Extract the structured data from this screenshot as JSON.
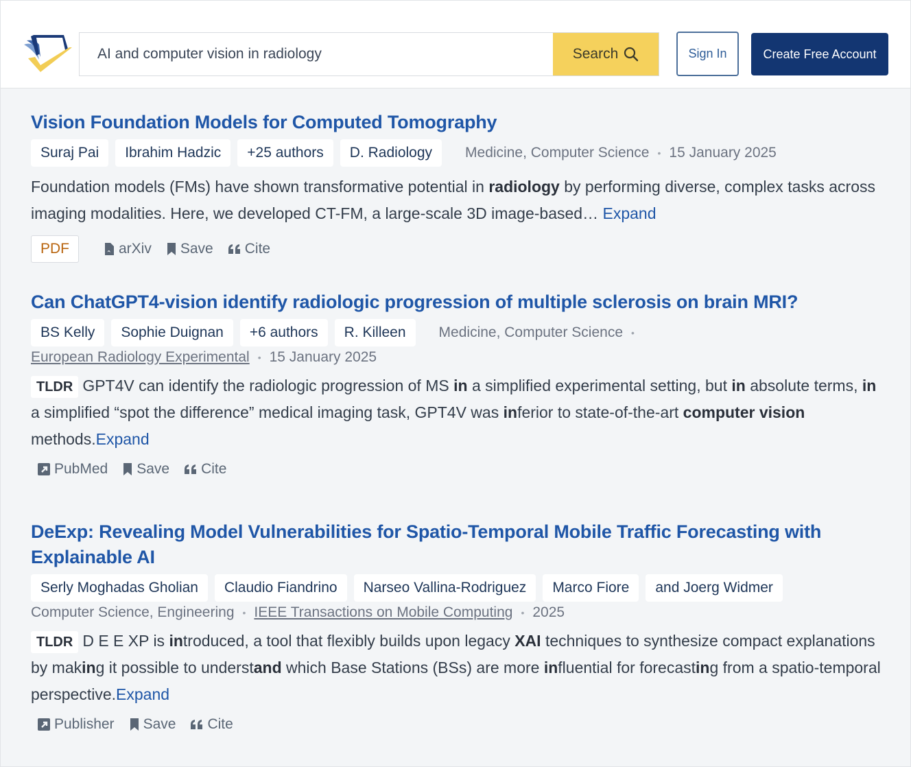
{
  "header": {
    "search_value": "AI and computer vision in radiology",
    "search_button": "Search",
    "sign_in": "Sign In",
    "create_account": "Create Free Account"
  },
  "colors": {
    "accent_yellow": "#f5d15c",
    "brand_navy": "#133672",
    "link_blue": "#1f56a7",
    "pdf_orange": "#b9650f"
  },
  "papers": [
    {
      "title": "Vision Foundation Models for Computed Tomography",
      "authors": [
        "Suraj Pai",
        "Ibrahim Hadzic",
        "+25 authors",
        "D. Radiology"
      ],
      "fields": "Medicine, Computer Science",
      "date": "15 January 2025",
      "abstract": [
        {
          "t": "Foundation models (FMs) have shown transformative potential in ",
          "b": false
        },
        {
          "t": "radiology",
          "b": true
        },
        {
          "t": " by performing diverse, complex tasks across imaging modalities. Here, we developed CT-FM, a large-scale 3D image-based… ",
          "b": false
        }
      ],
      "expand": "Expand",
      "pdf": "PDF",
      "actions": [
        {
          "icon": "pdf-file-icon",
          "label": "arXiv"
        },
        {
          "icon": "bookmark-icon",
          "label": "Save"
        },
        {
          "icon": "quote-icon",
          "label": "Cite"
        }
      ]
    },
    {
      "title": "Can ChatGPT4-vision identify radiologic progression of multiple sclerosis on brain MRI?",
      "authors": [
        "BS Kelly",
        "Sophie Duignan",
        "+6 authors",
        "R. Killeen"
      ],
      "fields": "Medicine, Computer Science",
      "venue": "European Radiology Experimental",
      "date": "15 January 2025",
      "tldr_label": "TLDR",
      "abstract": [
        {
          "t": "GPT4V can identify the radiologic progression of MS ",
          "b": false
        },
        {
          "t": "in",
          "b": true
        },
        {
          "t": " a simplified experimental setting, but ",
          "b": false
        },
        {
          "t": "in",
          "b": true
        },
        {
          "t": " absolute terms, ",
          "b": false
        },
        {
          "t": "in",
          "b": true
        },
        {
          "t": " a simplified “spot the difference” medical imaging task, GPT4V was ",
          "b": false
        },
        {
          "t": "in",
          "b": true
        },
        {
          "t": "ferior to state-of-the-art ",
          "b": false
        },
        {
          "t": "computer vision",
          "b": true
        },
        {
          "t": " methods.",
          "b": false
        }
      ],
      "expand": "Expand",
      "actions": [
        {
          "icon": "external-link-icon",
          "label": "PubMed"
        },
        {
          "icon": "bookmark-icon",
          "label": "Save"
        },
        {
          "icon": "quote-icon",
          "label": "Cite"
        }
      ]
    },
    {
      "title": "DeExp: Revealing Model Vulnerabilities for Spatio-Temporal Mobile Traffic Forecasting with Explainable AI",
      "authors": [
        "Serly Moghadas Gholian",
        "Claudio Fiandrino",
        "Narseo Vallina-Rodriguez",
        "Marco Fiore",
        "and Joerg Widmer"
      ],
      "fields": "Computer Science, Engineering",
      "venue": "IEEE Transactions on Mobile Computing",
      "date": "2025",
      "tldr_label": "TLDR",
      "abstract": [
        {
          "t": "D E E XP is ",
          "b": false
        },
        {
          "t": "in",
          "b": true
        },
        {
          "t": "troduced, a tool that flexibly builds upon legacy ",
          "b": false
        },
        {
          "t": "XAI",
          "b": true
        },
        {
          "t": " techniques to synthesize compact explanations by mak",
          "b": false
        },
        {
          "t": "in",
          "b": true
        },
        {
          "t": "g it possible to underst",
          "b": false
        },
        {
          "t": "and",
          "b": true
        },
        {
          "t": " which Base Stations (BSs) are more ",
          "b": false
        },
        {
          "t": "in",
          "b": true
        },
        {
          "t": "fluential for forecast",
          "b": false
        },
        {
          "t": "in",
          "b": true
        },
        {
          "t": "g from a spatio-temporal perspective.",
          "b": false
        }
      ],
      "expand": "Expand",
      "actions": [
        {
          "icon": "external-link-icon",
          "label": "Publisher"
        },
        {
          "icon": "bookmark-icon",
          "label": "Save"
        },
        {
          "icon": "quote-icon",
          "label": "Cite"
        }
      ]
    }
  ]
}
